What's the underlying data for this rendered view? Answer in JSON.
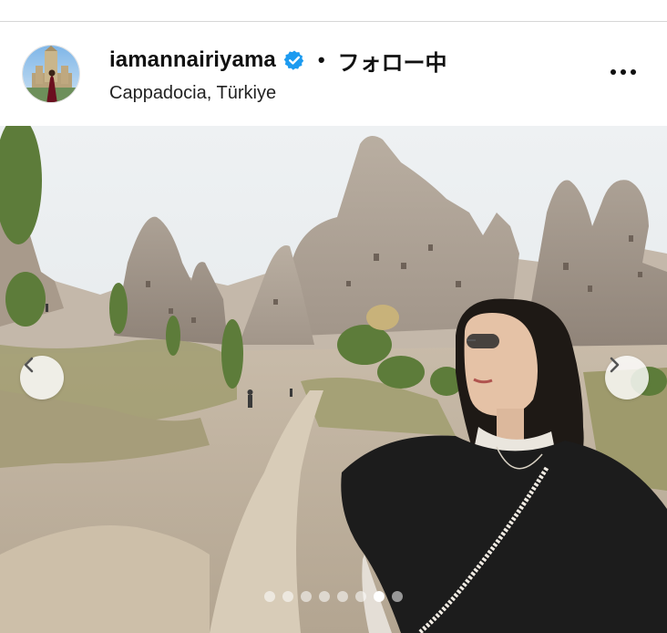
{
  "post": {
    "username": "iamannairiyama",
    "separator": "•",
    "follow_status": "フォロー中",
    "location": "Cappadocia, Türkiye",
    "verified_icon": "verified-badge-icon",
    "more_icon": "more-options-icon"
  },
  "carousel": {
    "total_slides": 8,
    "active_slide": 7,
    "prev_icon": "chevron-left-icon",
    "next_icon": "chevron-right-icon"
  },
  "colors": {
    "verified_blue": "#1d9bf0",
    "text": "#111111"
  }
}
